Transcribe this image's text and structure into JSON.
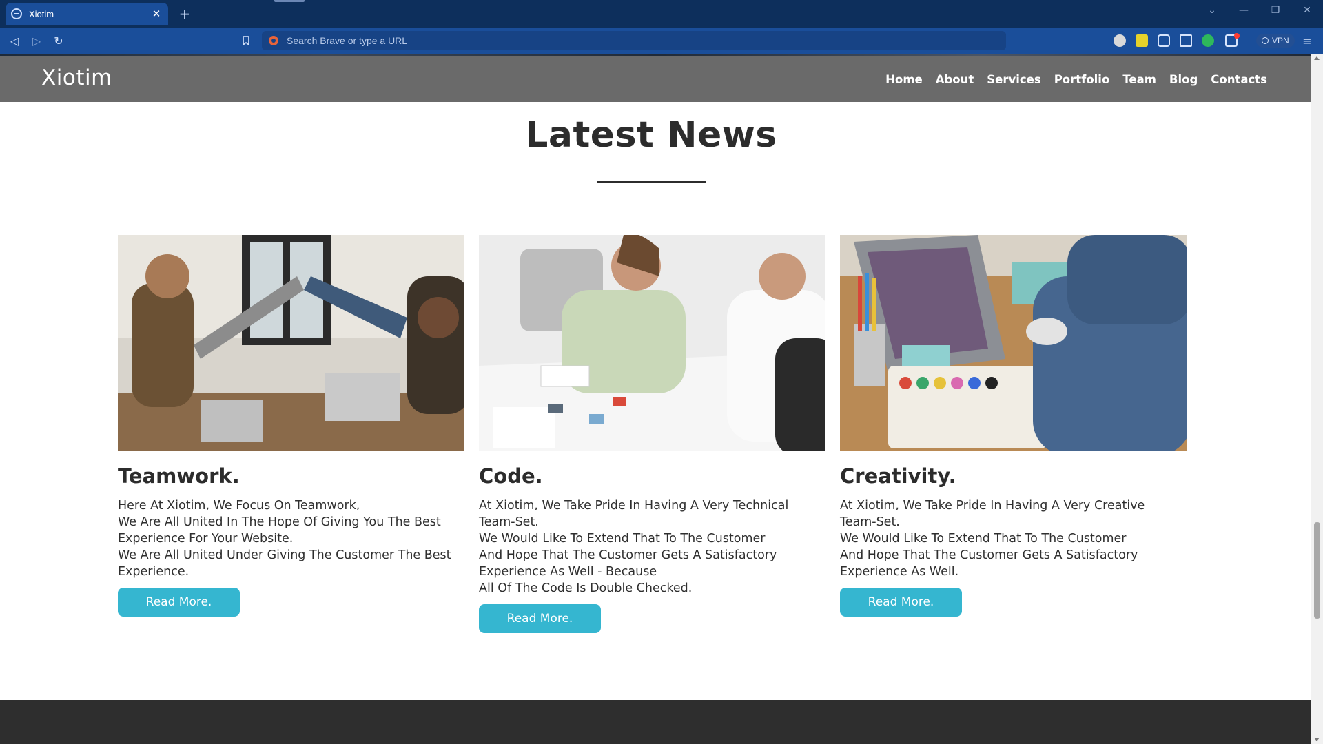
{
  "browser": {
    "tab_title": "Xiotim",
    "tab_close": "✕",
    "new_tab": "+",
    "address_placeholder": "Search Brave or type a URL",
    "vpn_label": "VPN"
  },
  "site": {
    "logo": "Xiotim",
    "nav": [
      "Home",
      "About",
      "Services",
      "Portfolio",
      "Team",
      "Blog",
      "Contacts"
    ]
  },
  "news": {
    "title": "Latest News",
    "cards": [
      {
        "title": "Teamwork.",
        "lines": [
          "Here At Xiotim, We Focus On Teamwork,",
          "We Are All United In The Hope Of Giving You The Best",
          "Experience For Your Website.",
          "We Are All United Under Giving The Customer The Best",
          "Experience."
        ],
        "button": "Read More.",
        "image_alt": "Team high-five around a table"
      },
      {
        "title": "Code.",
        "lines": [
          "At Xiotim, We Take Pride In Having A Very Technical",
          "Team-Set.",
          "We Would Like To Extend That To The Customer",
          "And Hope That The Customer Gets A Satisfactory",
          "Experience As Well - Because",
          "All Of The Code Is Double Checked."
        ],
        "button": "Read More.",
        "image_alt": "Colleagues laughing at a white table"
      },
      {
        "title": "Creativity.",
        "lines": [
          "At Xiotim, We Take Pride In Having A Very Creative",
          "Team-Set.",
          "We Would Like To Extend That To The Customer",
          "And Hope That The Customer Gets A Satisfactory",
          "Experience As Well."
        ],
        "button": "Read More.",
        "image_alt": "Laptop, paint palette and pencils on a desk"
      }
    ]
  },
  "colors": {
    "header_bg": "#6a6a6a",
    "accent_button": "#35b6d0",
    "title_text": "#2c2c2c",
    "footer_bg": "#2e2e2e",
    "browser_tabstrip": "#0d2f5c",
    "browser_toolbar": "#1a4e9a"
  }
}
